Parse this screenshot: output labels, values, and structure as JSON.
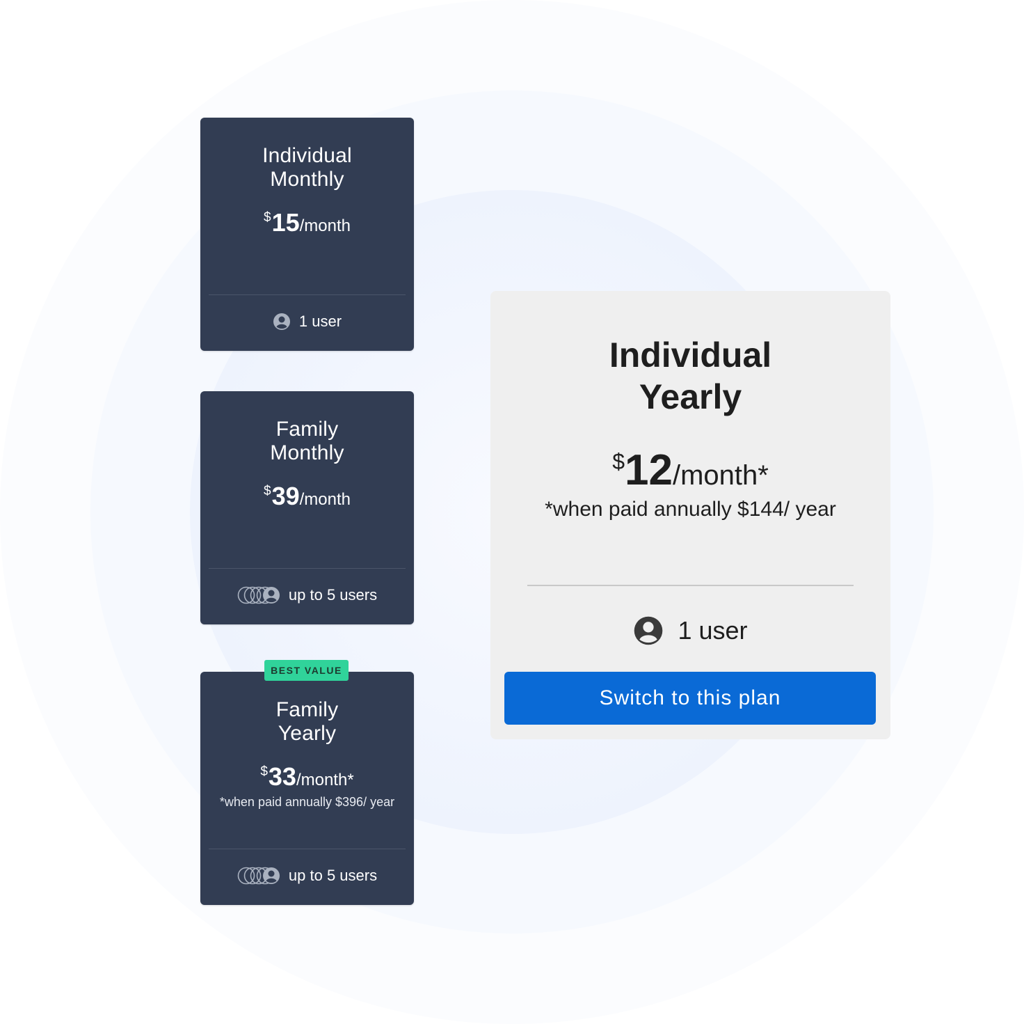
{
  "plans": [
    {
      "title_line1": "Individual",
      "title_line2": "Monthly",
      "currency": "$",
      "amount": "15",
      "period": "/month",
      "users": "1 user",
      "user_icon": "user-icon"
    },
    {
      "title_line1": "Family",
      "title_line2": "Monthly",
      "currency": "$",
      "amount": "39",
      "period": "/month",
      "users": "up to 5 users",
      "user_icon": "multi-user-icon"
    },
    {
      "title_line1": "Family",
      "title_line2": "Yearly",
      "currency": "$",
      "amount": "33",
      "period": "/month*",
      "note": "*when paid annually $396/ year",
      "users": "up to 5 users",
      "user_icon": "multi-user-icon",
      "badge": "BEST VALUE"
    }
  ],
  "selected": {
    "title_line1": "Individual",
    "title_line2": "Yearly",
    "currency": "$",
    "amount": "12",
    "period": "/month*",
    "note": "*when paid annually $144/ year",
    "users": "1 user",
    "user_icon": "user-icon",
    "button_label": "Switch to this plan"
  },
  "colors": {
    "card_bg": "#323d53",
    "badge": "#30d39a",
    "button": "#0a6ad6",
    "detail_bg": "#efefef"
  }
}
